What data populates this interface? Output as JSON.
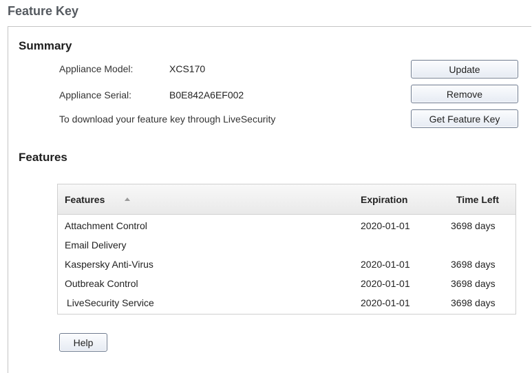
{
  "page": {
    "title": "Feature Key"
  },
  "summary": {
    "title": "Summary",
    "model_label": "Appliance Model:",
    "model_value": "XCS170",
    "serial_label": "Appliance Serial:",
    "serial_value": "B0E842A6EF002",
    "download_text": "To download your feature key through LiveSecurity",
    "buttons": {
      "update": "Update",
      "remove": "Remove",
      "get_key": "Get Feature Key"
    }
  },
  "features": {
    "title": "Features",
    "columns": [
      "Features",
      "Expiration",
      "Time Left"
    ],
    "sort_icon": "sort-ascending-icon",
    "rows": [
      {
        "name": "Attachment Control",
        "expiration": "2020-01-01",
        "time_left": "3698 days"
      },
      {
        "name": "Email Delivery",
        "expiration": "",
        "time_left": ""
      },
      {
        "name": "Kaspersky Anti-Virus",
        "expiration": "2020-01-01",
        "time_left": "3698 days"
      },
      {
        "name": "Outbreak Control",
        "expiration": "2020-01-01",
        "time_left": "3698 days"
      },
      {
        "name": "LiveSecurity Service",
        "expiration": "2020-01-01",
        "time_left": "3698 days"
      }
    ]
  },
  "help_button": "Help",
  "colors": {
    "title": "#555a60",
    "button_border": "#6d7a8f"
  }
}
